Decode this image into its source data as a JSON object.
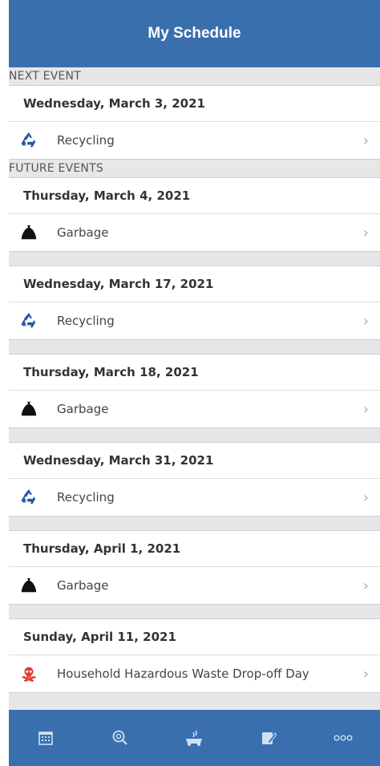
{
  "header": {
    "title": "My Schedule"
  },
  "sections": {
    "next_label": "NEXT EVENT",
    "future_label": "FUTURE EVENTS"
  },
  "next_event": {
    "date": "Wednesday, March 3, 2021",
    "event": "Recycling",
    "icon": "recycle-icon"
  },
  "future_events": [
    {
      "date": "Thursday, March 4, 2021",
      "event": "Garbage",
      "icon": "garbage-bag-icon"
    },
    {
      "date": "Wednesday, March 17, 2021",
      "event": "Recycling",
      "icon": "recycle-icon"
    },
    {
      "date": "Thursday, March 18, 2021",
      "event": "Garbage",
      "icon": "garbage-bag-icon"
    },
    {
      "date": "Wednesday, March 31, 2021",
      "event": "Recycling",
      "icon": "recycle-icon"
    },
    {
      "date": "Thursday, April 1, 2021",
      "event": "Garbage",
      "icon": "garbage-bag-icon"
    },
    {
      "date": "Sunday, April 11, 2021",
      "event": "Household Hazardous Waste Drop-off Day",
      "icon": "hazard-skull-icon"
    }
  ],
  "chevron": "›",
  "tabs": [
    {
      "icon": "calendar-icon"
    },
    {
      "icon": "search-icon"
    },
    {
      "icon": "waste-wizard-icon"
    },
    {
      "icon": "report-icon"
    },
    {
      "icon": "more-icon"
    }
  ],
  "colors": {
    "primary": "#3a6fae",
    "recycle": "#2a5aa2",
    "hazard": "#e33b2e",
    "garbage": "#111111"
  }
}
